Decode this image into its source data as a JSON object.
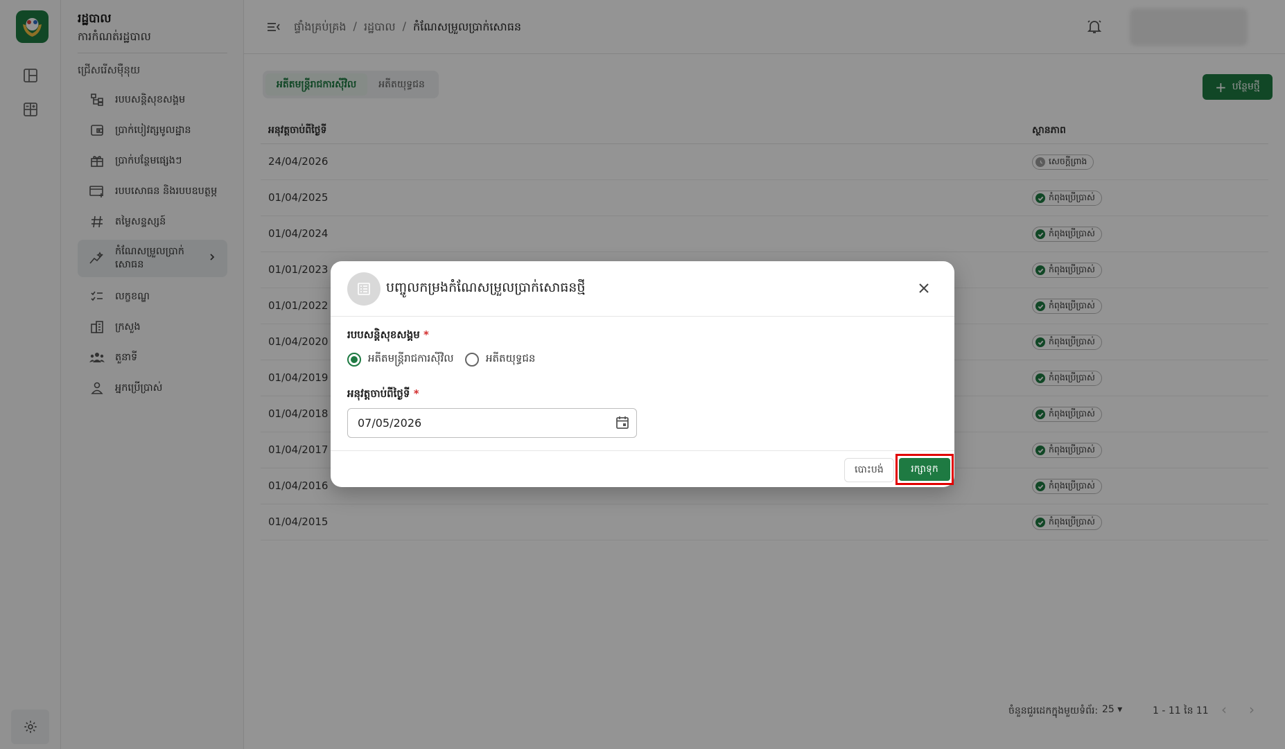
{
  "app": {
    "title": "រដ្ឋបាល",
    "subtitle": "ការកំណត់រដ្ឋបាល",
    "section_label": "ជ្រើសរើសម៉ឺនុយ"
  },
  "sidebar": {
    "items": [
      {
        "label": "របបសន្តិសុខសង្គម",
        "icon": "hierarchy-icon"
      },
      {
        "label": "ប្រាក់បៀវត្សមូលដ្ឋាន",
        "icon": "wallet-icon"
      },
      {
        "label": "ប្រាក់បន្ថែមផ្សេងៗ",
        "icon": "gift-icon"
      },
      {
        "label": "របបសោធន និងរបបឧបត្ថម្ភ",
        "icon": "card-plus-icon"
      },
      {
        "label": "តម្លៃសន្ទស្សន៍",
        "icon": "hash-icon"
      },
      {
        "label": "កំណែសម្រួលប្រាក់សោធន",
        "icon": "chart-icon",
        "active": true
      },
      {
        "label": "លក្ខខណ្ឌ",
        "icon": "checklist-icon"
      },
      {
        "label": "ក្រសួង",
        "icon": "building-icon"
      },
      {
        "label": "តួនាទី",
        "icon": "group-icon"
      },
      {
        "label": "អ្នកប្រើប្រាស់",
        "icon": "user-icon"
      }
    ]
  },
  "breadcrumb": [
    "ផ្ទាំងគ្រប់គ្រង",
    "រដ្ឋបាល",
    "កំណែសម្រួលប្រាក់សោធន"
  ],
  "tabs": [
    {
      "label": "អតីតមន្ត្រីរាជការស៊ីវិល",
      "active": true
    },
    {
      "label": "អតីតយុទ្ធជន",
      "active": false
    }
  ],
  "add_button": "បន្ថែមថ្មី",
  "table": {
    "columns": [
      "អនុវត្តចាប់ពីថ្ងៃទី",
      "ស្ថានភាព"
    ],
    "rows": [
      {
        "date": "24/04/2026",
        "status": "សេចក្តីព្រាង",
        "state": "pending"
      },
      {
        "date": "01/04/2025",
        "status": "កំពុងប្រើប្រាស់",
        "state": "active"
      },
      {
        "date": "01/04/2024",
        "status": "កំពុងប្រើប្រាស់",
        "state": "active"
      },
      {
        "date": "01/01/2023",
        "status": "កំពុងប្រើប្រាស់",
        "state": "active"
      },
      {
        "date": "01/01/2022",
        "status": "កំពុងប្រើប្រាស់",
        "state": "active"
      },
      {
        "date": "01/04/2020",
        "status": "កំពុងប្រើប្រាស់",
        "state": "active"
      },
      {
        "date": "01/04/2019",
        "status": "កំពុងប្រើប្រាស់",
        "state": "active"
      },
      {
        "date": "01/04/2018",
        "status": "កំពុងប្រើប្រាស់",
        "state": "active"
      },
      {
        "date": "01/04/2017",
        "status": "កំពុងប្រើប្រាស់",
        "state": "active"
      },
      {
        "date": "01/04/2016",
        "status": "កំពុងប្រើប្រាស់",
        "state": "active"
      },
      {
        "date": "01/04/2015",
        "status": "កំពុងប្រើប្រាស់",
        "state": "active"
      }
    ]
  },
  "pagination": {
    "rows_per_page_label": "ចំនួនជួរដេកក្នុងមួយទំព័រ:",
    "rows_per_page": "25",
    "range": "1 - 11 នៃ 11"
  },
  "dialog": {
    "title": "បញ្ចូលកម្រងកំណែសម្រួលប្រាក់សោធនថ្មី",
    "field_scheme_label": "របបសន្តិសុខសង្គម",
    "required_mark": "*",
    "radio_options": [
      {
        "label": "អតីតមន្ត្រីរាជការស៊ីវិល",
        "checked": true
      },
      {
        "label": "អតីតយុទ្ធជន",
        "checked": false
      }
    ],
    "field_date_label": "អនុវត្តចាប់ពីថ្ងៃទី",
    "date_value": "07/05/2026",
    "cancel_label": "បោះបង់",
    "save_label": "រក្សាទុក"
  },
  "colors": {
    "brand": "#1e7a42",
    "highlight": "#e10000",
    "required": "#d32f2f"
  }
}
